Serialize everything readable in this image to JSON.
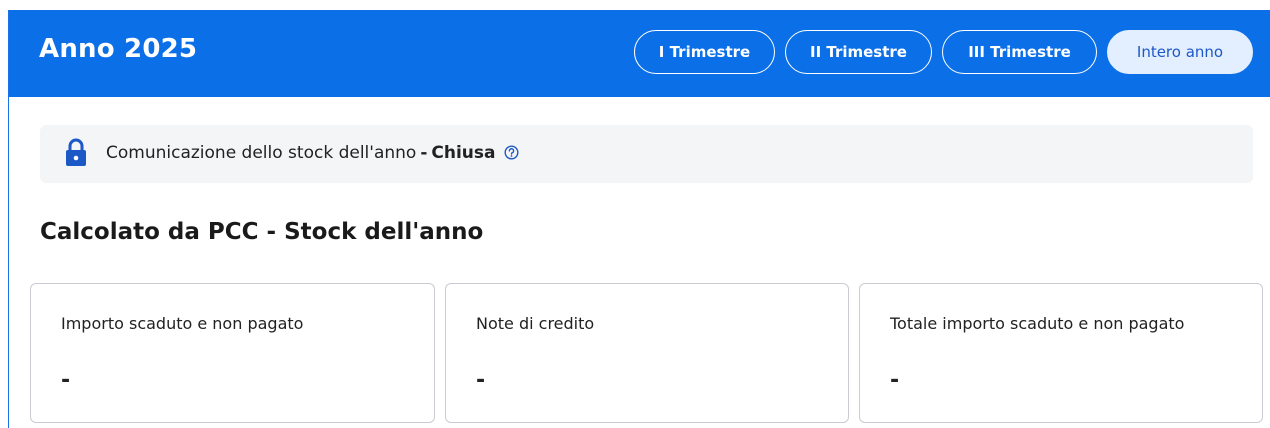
{
  "header": {
    "title": "Anno 2025",
    "tabs": [
      {
        "label": "I Trimestre",
        "active": false
      },
      {
        "label": "II Trimestre",
        "active": false
      },
      {
        "label": "III Trimestre",
        "active": false
      },
      {
        "label": "Intero anno",
        "active": true
      }
    ]
  },
  "notice": {
    "icon": "lock-icon",
    "text": "Comunicazione dello stock dell'anno",
    "separator": "-",
    "status": "Chiusa",
    "help_icon": "question-circle-icon"
  },
  "section": {
    "title": "Calcolato da PCC - Stock dell'anno"
  },
  "cards": [
    {
      "label": "Importo scaduto e non pagato",
      "value": "-"
    },
    {
      "label": "Note di credito",
      "value": "-"
    },
    {
      "label": "Totale importo scaduto e non pagato",
      "value": "-"
    }
  ],
  "colors": {
    "header_bg": "#0b6fe8",
    "active_tab_bg": "#e3eeff",
    "active_tab_text": "#1d58c7",
    "notice_bg": "#f4f5f7",
    "icon_blue": "#1d58c7"
  }
}
